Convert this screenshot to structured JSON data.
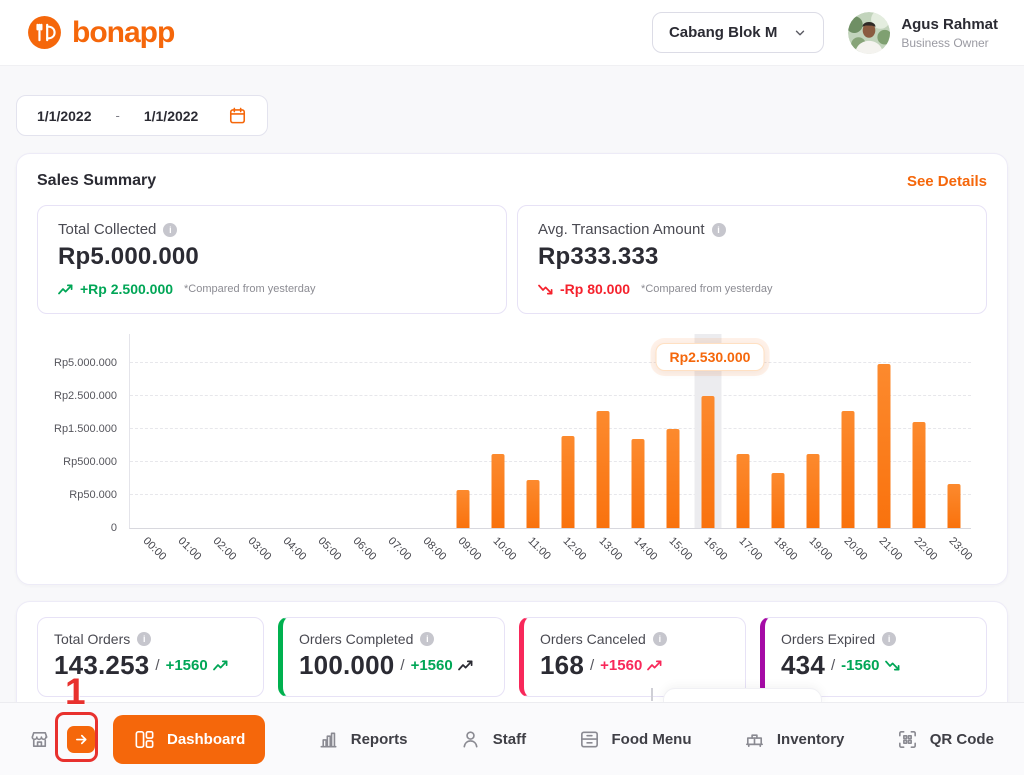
{
  "colors": {
    "orange": "#F5670B",
    "bar_orange": "#FB7A1F",
    "green": "#00A656",
    "red": "#F5222D",
    "pink": "#F8285A",
    "purple": "#A50BA6",
    "annotation_red": "#E8312E"
  },
  "header": {
    "brand": "bonapp",
    "branch_selector": {
      "label": "Cabang Blok M",
      "icon": "chevron-down-icon"
    },
    "user": {
      "name": "Agus Rahmat",
      "role": "Business Owner"
    }
  },
  "date_filter": {
    "start": "1/1/2022",
    "separator": "-",
    "end": "1/1/2022",
    "icon": "calendar-icon"
  },
  "sales_summary": {
    "title": "Sales Summary",
    "see_details": "See Details",
    "stats": [
      {
        "label": "Total Collected",
        "value": "Rp5.000.000",
        "delta": "+Rp 2.500.000",
        "delta_color": "#00A656",
        "arrow": "up",
        "arrow_color": "#00A656",
        "note": "*Compared from yesterday",
        "info_icon": "info-icon"
      },
      {
        "label": "Avg. Transaction Amount",
        "value": "Rp333.333",
        "delta": "-Rp 80.000",
        "delta_color": "#F5222D",
        "arrow": "down",
        "arrow_color": "#F5222D",
        "note": "*Compared from yesterday",
        "info_icon": "info-icon"
      }
    ]
  },
  "chart_data": {
    "type": "bar",
    "title": "",
    "xlabel": "",
    "ylabel": "",
    "x": [
      "00:00",
      "01:00",
      "02:00",
      "03:00",
      "04:00",
      "05:00",
      "06:00",
      "07:00",
      "08:00",
      "09:00",
      "10:00",
      "11:00",
      "12:00",
      "13:00",
      "14:00",
      "15:00",
      "16:00",
      "17:00",
      "18:00",
      "19:00",
      "20:00",
      "21:00",
      "22:00",
      "23:00"
    ],
    "values": [
      0,
      0,
      0,
      0,
      0,
      0,
      0,
      0,
      0,
      120000,
      750000,
      250000,
      1300000,
      2050000,
      1200000,
      1500000,
      2530000,
      750000,
      350000,
      750000,
      2050000,
      4900000,
      1700000,
      200000
    ],
    "y_ticks": {
      "labels": [
        "0",
        "Rp50.000",
        "Rp500.000",
        "Rp1.500.000",
        "Rp2.500.000",
        "Rp5.000.000"
      ],
      "values": [
        0,
        50000,
        500000,
        1500000,
        2500000,
        5000000
      ]
    },
    "grid": "dashed-horizontal",
    "legend": "none",
    "bar_color": "#FB7A1F",
    "highlight_index": 16,
    "tooltip": {
      "index": 16,
      "text": "Rp2.530.000"
    }
  },
  "orders": {
    "cards": [
      {
        "label": "Total Orders",
        "value": "143.253",
        "slash": "/",
        "delta": "+1560",
        "delta_color": "#00A656",
        "arrow": "up",
        "arrow_color": "#00A656",
        "accent": "",
        "info_icon": "info-icon"
      },
      {
        "label": "Orders Completed",
        "value": "100.000",
        "slash": "/",
        "delta": "+1560",
        "delta_color": "#00A656",
        "arrow": "up",
        "arrow_color": "#2B2B33",
        "accent": "#00B14F",
        "info_icon": "info-icon"
      },
      {
        "label": "Orders Canceled",
        "value": "168",
        "slash": "/",
        "delta": "+1560",
        "delta_color": "#F8285A",
        "arrow": "up",
        "arrow_color": "#F8285A",
        "accent": "#F8285A",
        "info_icon": "info-icon"
      },
      {
        "label": "Orders Expired",
        "value": "434",
        "slash": "/",
        "delta": "-1560",
        "delta_color": "#00A656",
        "arrow": "down",
        "arrow_color": "#00A656",
        "accent": "#A50BA6",
        "info_icon": "info-icon"
      }
    ]
  },
  "nav": {
    "items": [
      {
        "label": "Dashboard",
        "icon": "dashboard-icon",
        "active": true
      },
      {
        "label": "Reports",
        "icon": "reports-icon",
        "active": false
      },
      {
        "label": "Staff",
        "icon": "staff-icon",
        "active": false
      },
      {
        "label": "Food Menu",
        "icon": "food-menu-icon",
        "active": false
      },
      {
        "label": "Inventory",
        "icon": "inventory-icon",
        "active": false
      },
      {
        "label": "QR Code",
        "icon": "qr-code-icon",
        "active": false
      }
    ]
  },
  "annotation": {
    "step_label": "1"
  }
}
